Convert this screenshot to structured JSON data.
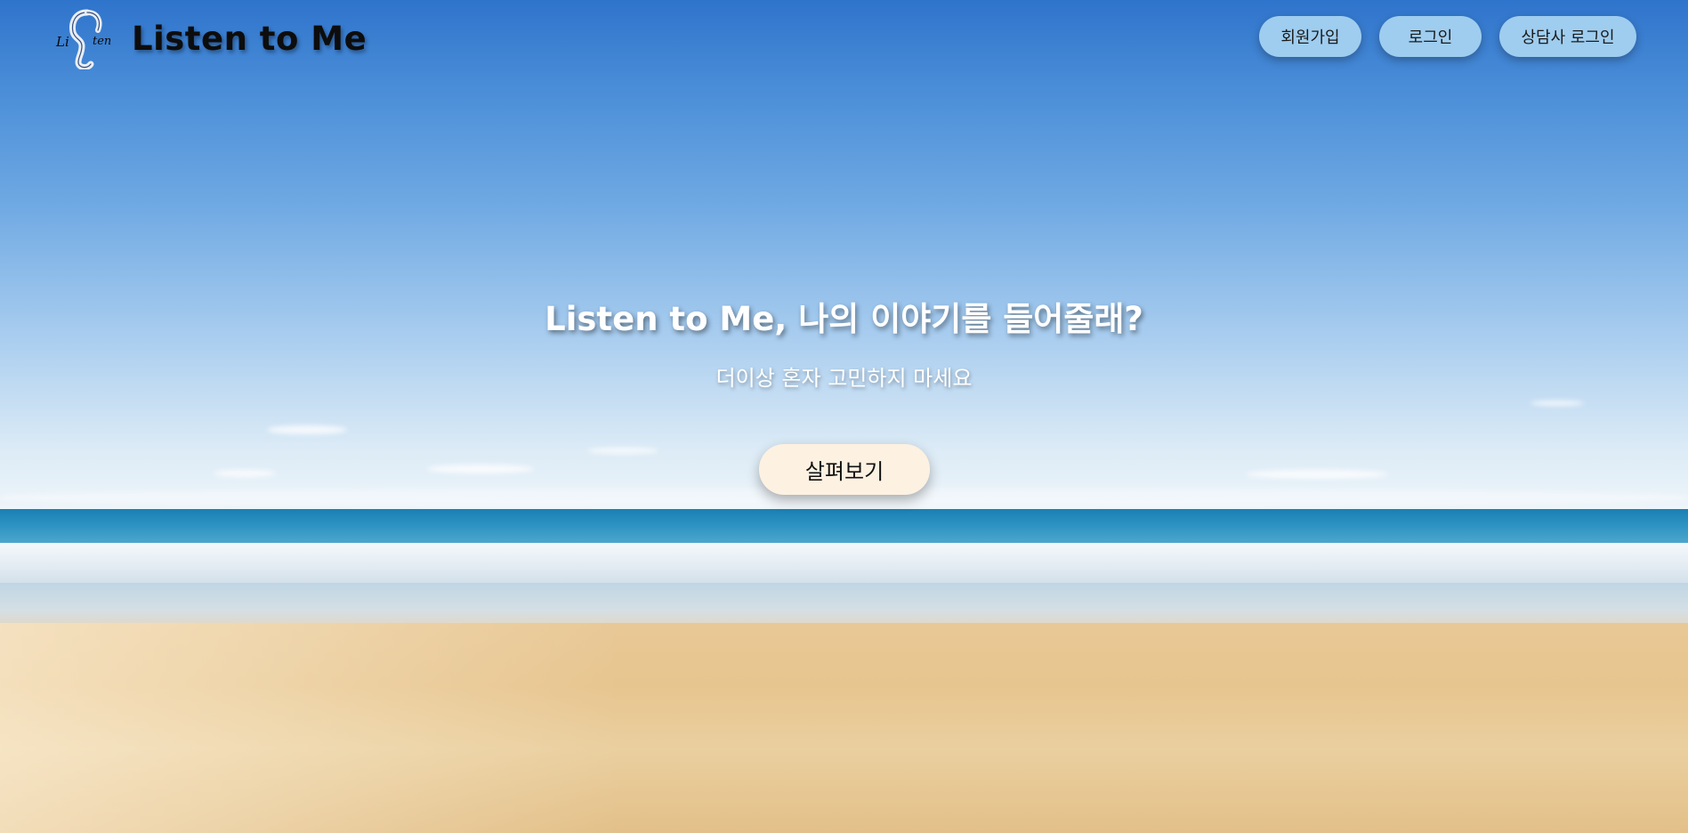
{
  "brand": {
    "title": "Listen to Me",
    "logo_icon": "ear-logo-icon"
  },
  "nav": {
    "signup_label": "회원가입",
    "login_label": "로그인",
    "counselor_login_label": "상담사 로그인"
  },
  "hero": {
    "headline": "Listen to Me, 나의 이야기를 들어줄래?",
    "subline": "더이상 혼자 고민하지 마세요",
    "explore_label": "살펴보기",
    "background": "beach-sky-background"
  },
  "colors": {
    "nav_button_bg": "#9fcdef",
    "explore_button_bg": "#fdf1e2",
    "headline_text": "#ffffff",
    "brand_text": "#0d0d0d"
  }
}
